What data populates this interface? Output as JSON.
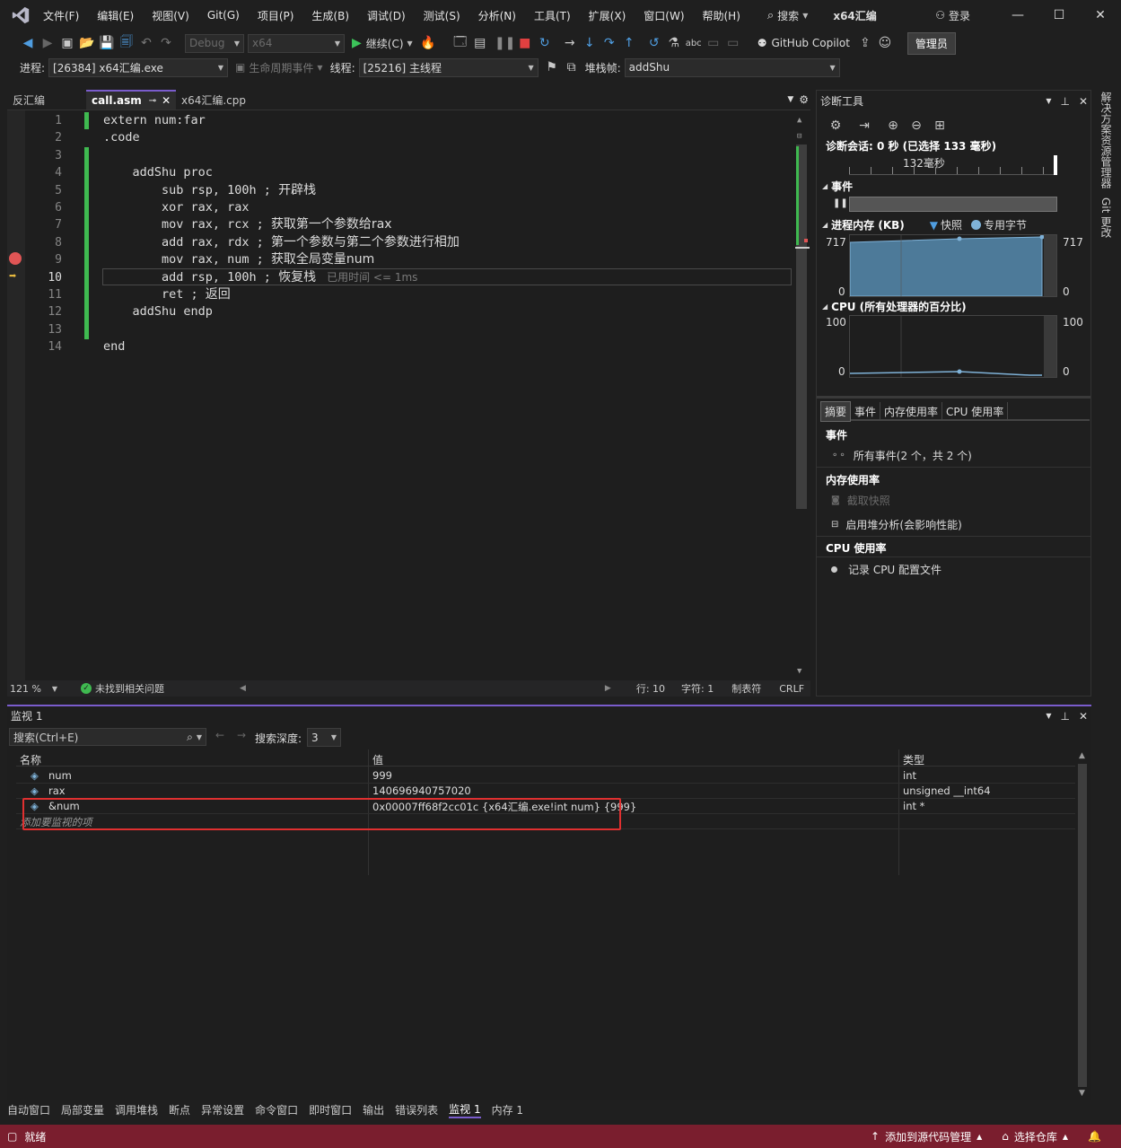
{
  "titlebar": {
    "menus": [
      "文件(F)",
      "编辑(E)",
      "视图(V)",
      "Git(G)",
      "项目(P)",
      "生成(B)",
      "调试(D)",
      "测试(S)",
      "分析(N)",
      "工具(T)",
      "扩展(X)",
      "窗口(W)",
      "帮助(H)"
    ],
    "search_label": "搜索",
    "project_name": "x64汇编",
    "login_label": "登录"
  },
  "toolbar": {
    "config": "Debug",
    "platform": "x64",
    "continue_label": "继续(C)",
    "copilot_label": "GitHub Copilot",
    "admin_label": "管理员"
  },
  "debugbar": {
    "process_label": "进程:",
    "process_value": "[26384] x64汇编.exe",
    "lifecycle_label": "生命周期事件",
    "thread_label": "线程:",
    "thread_value": "[25216] 主线程",
    "stackframe_label": "堆栈帧:",
    "stackframe_value": "addShu"
  },
  "editor": {
    "tabs": [
      {
        "label": "反汇编",
        "active": false
      },
      {
        "label": "call.asm",
        "active": true
      },
      {
        "label": "x64汇编.cpp",
        "active": false
      }
    ],
    "lines": [
      {
        "n": "1",
        "code": "extern num:far"
      },
      {
        "n": "2",
        "code": ".code"
      },
      {
        "n": "3",
        "code": ""
      },
      {
        "n": "4",
        "code": "    addShu proc"
      },
      {
        "n": "5",
        "code": "        sub rsp, 100h ; ",
        "comment": "开辟栈"
      },
      {
        "n": "6",
        "code": "        xor rax, rax"
      },
      {
        "n": "7",
        "code": "        mov rax, rcx ; ",
        "comment": "获取第一个参数给rax"
      },
      {
        "n": "8",
        "code": "        add rax, rdx ; ",
        "comment": "第一个参数与第二个参数进行相加"
      },
      {
        "n": "9",
        "code": "        mov rax, num ; ",
        "comment": "获取全局变量num"
      },
      {
        "n": "10",
        "code": "        add rsp, 100h ; ",
        "comment": "恢复栈",
        "hint": "已用时间 <= 1ms"
      },
      {
        "n": "11",
        "code": "        ret ; ",
        "comment": "返回"
      },
      {
        "n": "12",
        "code": "    addShu endp"
      },
      {
        "n": "13",
        "code": ""
      },
      {
        "n": "14",
        "code": "end"
      }
    ],
    "status": {
      "zoom": "121 %",
      "issues": "未找到相关问题",
      "line": "行: 10",
      "char": "字符: 1",
      "tabs": "制表符",
      "eol": "CRLF"
    }
  },
  "diag": {
    "title": "诊断工具",
    "session": "诊断会话: 0 秒 (已选择 133 毫秒)",
    "timeline_label": "132毫秒",
    "events_title": "事件",
    "memory_title": "进程内存 (KB)",
    "memory_legend_snapshot": "快照",
    "memory_legend_private": "专用字节",
    "memory_max": "717",
    "memory_min": "0",
    "cpu_title": "CPU (所有处理器的百分比)",
    "cpu_max": "100",
    "cpu_min": "0",
    "tabs": [
      "摘要",
      "事件",
      "内存使用率",
      "CPU 使用率"
    ],
    "summary": {
      "events_header": "事件",
      "all_events": "所有事件(2 个，共 2 个)",
      "memory_header": "内存使用率",
      "snapshot": "截取快照",
      "heap": "启用堆分析(会影响性能)",
      "cpu_header": "CPU 使用率",
      "record_cpu": "记录 CPU 配置文件"
    },
    "side_tabs": [
      "解决方案资源管理器",
      "Git 更改"
    ]
  },
  "watch": {
    "title": "监视 1",
    "search_placeholder": "搜索(Ctrl+E)",
    "depth_label": "搜索深度:",
    "depth_value": "3",
    "columns": [
      "名称",
      "值",
      "类型"
    ],
    "rows": [
      {
        "name": "num",
        "value": "999",
        "type": "int"
      },
      {
        "name": "rax",
        "value": "140696940757020",
        "type": "unsigned __int64"
      },
      {
        "name": "&num",
        "value": "0x00007ff68f2cc01c {x64汇编.exe!int num} {999}",
        "type": "int *"
      }
    ],
    "add_placeholder": "添加要监视的项",
    "highlight_color": "#e03030"
  },
  "bottom_tabs": [
    "自动窗口",
    "局部变量",
    "调用堆栈",
    "断点",
    "异常设置",
    "命令窗口",
    "即时窗口",
    "输出",
    "错误列表",
    "监视 1",
    "内存 1"
  ],
  "statusbar": {
    "ready": "就绪",
    "add_source": "添加到源代码管理",
    "select_repo": "选择仓库"
  }
}
